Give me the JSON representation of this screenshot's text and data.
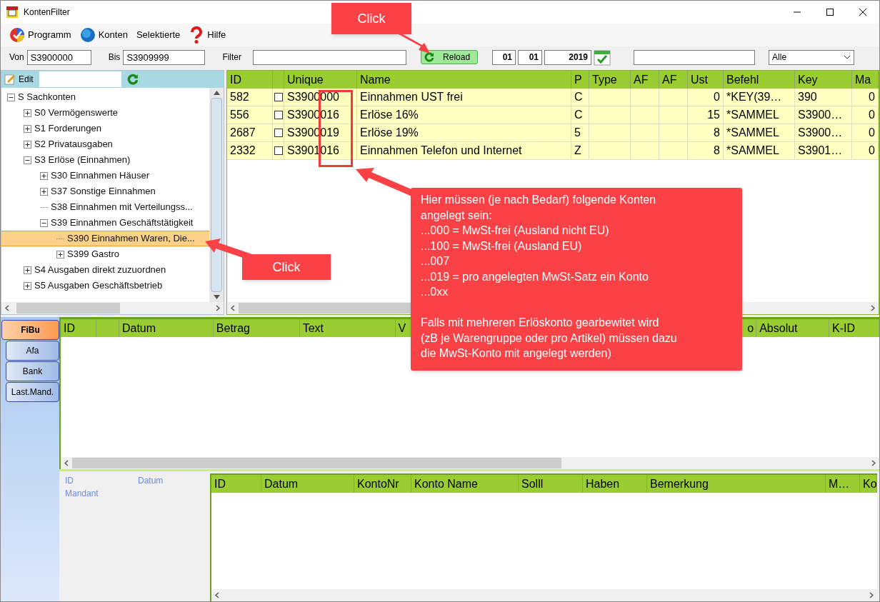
{
  "window": {
    "title": "KontenFilter"
  },
  "menu": [
    {
      "label": "Programm",
      "kind": "palette"
    },
    {
      "label": "Konten",
      "kind": "globe"
    },
    {
      "label": "Selektierte",
      "kind": "none"
    },
    {
      "label": "Hilfe",
      "kind": "help"
    }
  ],
  "filters": {
    "von_label": "Von",
    "von": "S3900000",
    "bis_label": "Bis",
    "bis": "S3909999",
    "filter_label": "Filter",
    "reload": "Reload",
    "day": "01",
    "month": "01",
    "year": "2019",
    "period": "Alle"
  },
  "tree_toolbar": {
    "edit": "Edit"
  },
  "tree": [
    {
      "label": "S Sachkonten",
      "expanded": true,
      "selected": false,
      "children": [
        {
          "label": "S0 Vermögenswerte",
          "expanded": false,
          "selected": false
        },
        {
          "label": "S1 Forderungen",
          "expanded": false,
          "selected": false
        },
        {
          "label": "S2 Privatausgaben",
          "expanded": false,
          "selected": false
        },
        {
          "label": "S3 Erlöse (Einnahmen)",
          "expanded": true,
          "selected": false,
          "children": [
            {
              "label": "S30 Einnahmen Häuser",
              "expanded": false,
              "selected": false
            },
            {
              "label": "S37 Sonstige Einnahmen",
              "expanded": false,
              "selected": false
            },
            {
              "label": "S38 Einnahmen mit Verteilungss...",
              "selected": false
            },
            {
              "label": "S39 Einnahmen Geschäftstätigkeit",
              "expanded": true,
              "selected": false,
              "children": [
                {
                  "label": "S390 Einnahmen Waren, Die...",
                  "selected": true
                },
                {
                  "label": "S399 Gastro",
                  "expanded": false,
                  "selected": false
                }
              ]
            }
          ]
        },
        {
          "label": "S4 Ausgaben direkt zuzuordnen",
          "expanded": false,
          "selected": false
        },
        {
          "label": "S5 Ausgaben Geschäftsbetrieb",
          "expanded": false,
          "selected": false
        }
      ]
    }
  ],
  "accounts": {
    "columns": [
      {
        "kind": "text",
        "label": "ID"
      },
      {
        "kind": "check"
      },
      {
        "kind": "text",
        "label": "Unique"
      },
      {
        "kind": "text",
        "label": "Name"
      },
      {
        "kind": "text",
        "label": "P"
      },
      {
        "kind": "text",
        "label": "Type"
      },
      {
        "kind": "text",
        "label": "AF"
      },
      {
        "kind": "text",
        "label": "AF"
      },
      {
        "kind": "number",
        "label": "Ust"
      },
      {
        "kind": "text",
        "label": "Befehl"
      },
      {
        "kind": "text",
        "label": "Key"
      },
      {
        "kind": "number",
        "label": "Ma"
      }
    ],
    "rows": [
      {
        "checked": false,
        "cells": [
          "582",
          null,
          "S3900000",
          "Einnahmen UST frei",
          "C",
          null,
          null,
          null,
          "0",
          "*KEY(39…",
          "390",
          "0"
        ]
      },
      {
        "checked": false,
        "cells": [
          "556",
          null,
          "S3900016",
          "Erlöse 16%",
          "C",
          null,
          null,
          null,
          "15",
          "*SAMMEL",
          "S3900…",
          "0"
        ]
      },
      {
        "checked": false,
        "cells": [
          "2687",
          null,
          "S3900019",
          "Erlöse 19%",
          "5",
          null,
          null,
          null,
          "8",
          "*SAMMEL",
          "S3900…",
          "0"
        ]
      },
      {
        "checked": false,
        "cells": [
          "2332",
          null,
          "S3901016",
          "Einnahmen Telefon und Internet",
          "Z",
          null,
          null,
          null,
          "8",
          "*SAMMEL",
          "S3901…",
          "0"
        ]
      }
    ]
  },
  "side_tabs": [
    {
      "label": "FiBu",
      "selected": true
    },
    {
      "label": "Afa",
      "selected": false
    },
    {
      "label": "Bank",
      "selected": false
    },
    {
      "label": "Last.Mand.",
      "selected": false
    }
  ],
  "bookings": {
    "columns": [
      {
        "kind": "text",
        "label": "ID"
      },
      {
        "kind": "blank"
      },
      {
        "kind": "text",
        "label": "Datum"
      },
      {
        "kind": "text",
        "label": "Betrag"
      },
      {
        "kind": "text",
        "label": "Text"
      },
      {
        "kind": "text",
        "label": "V"
      },
      {
        "kind": "end",
        "label": "o"
      },
      {
        "kind": "text",
        "label": "Absolut"
      },
      {
        "kind": "text",
        "label": "K-ID"
      }
    ]
  },
  "details": {
    "labels": [
      "ID",
      "Mandant",
      "Datum"
    ]
  },
  "journal": {
    "columns": [
      {
        "label": "ID"
      },
      {
        "label": "Datum"
      },
      {
        "label": "KontoNr"
      },
      {
        "label": "Konto Name"
      },
      {
        "label": "Solll"
      },
      {
        "label": "Haben"
      },
      {
        "label": "Bemerkung"
      },
      {
        "label": "M…"
      },
      {
        "label": "Ko"
      }
    ]
  },
  "annotations": [
    {
      "kind": "callout",
      "text": "Click"
    },
    {
      "kind": "note",
      "paragraphs": [
        [
          "Hier müssen (je nach Bedarf) folgende Konten",
          "angelegt sein:",
          "...000 = MwSt-frei (Ausland nicht EU)",
          "...100 = MwSt-frei (Ausland EU)",
          "...007",
          "...019 = pro angelegten MwSt-Satz ein Konto",
          "...0xx"
        ],
        [
          "Falls mit mehreren Erlöskonto gearbewitet wird",
          "(zB je Warengruppe oder pro Artikel) müssen dazu",
          "die MwSt-Konto mit angelegt werden)"
        ]
      ]
    },
    {
      "kind": "callout",
      "text": "Click"
    },
    {
      "kind": "highlight"
    }
  ]
}
